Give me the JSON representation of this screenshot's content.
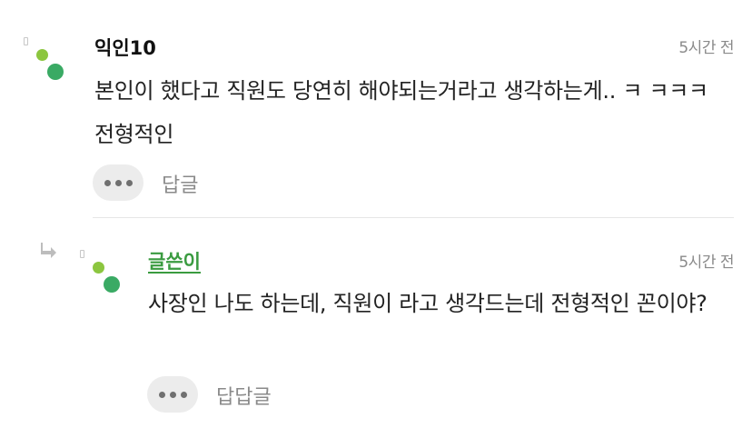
{
  "comments": [
    {
      "nickname": "익인10",
      "time": "5시간 전",
      "text": "본인이 했다고 직원도 당연히 해야되는거라고 생각하는게.. ㅋ ㅋㅋㅋ 전형적인",
      "reply_label": "답글",
      "is_author": false
    },
    {
      "nickname": "글쓴이",
      "time": "5시간 전",
      "text": "사장인 나도 하는데, 직원이 라고 생각드는데 전형적인 꼰이야?",
      "reply_label": "답답글",
      "is_author": true,
      "is_reply": true
    }
  ],
  "icons": {
    "more": "more-dots-icon",
    "reply_arrow": "reply-arrow-icon",
    "avatar": "avatar-dots-icon"
  },
  "colors": {
    "author_green": "#3a9b40",
    "avatar_light": "#8cc63f",
    "avatar_dark": "#3aaa64",
    "muted": "#8a8a8a"
  }
}
